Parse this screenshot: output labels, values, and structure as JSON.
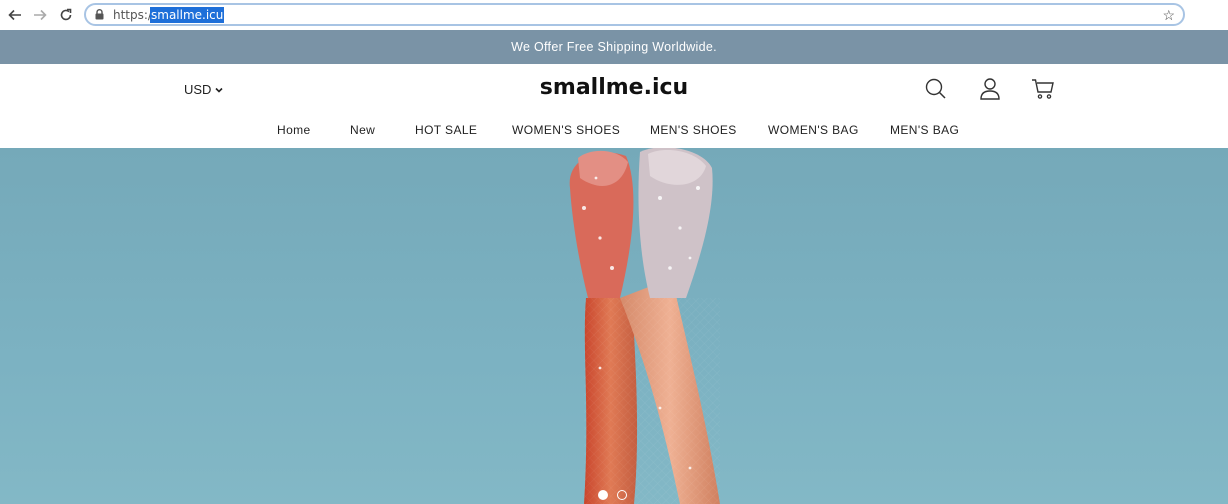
{
  "browser": {
    "url_scheme": "https://",
    "url_host": "smallme.icu"
  },
  "announcement": {
    "text": "We Offer Free Shipping Worldwide."
  },
  "header": {
    "currency": "USD",
    "logo": "smallme.icu",
    "icons": [
      "search-icon",
      "account-icon",
      "cart-icon"
    ]
  },
  "menu": {
    "items": [
      {
        "label": "Home"
      },
      {
        "label": "New"
      },
      {
        "label": "HOT SALE"
      },
      {
        "label": "WOMEN'S SHOES"
      },
      {
        "label": "MEN'S SHOES"
      },
      {
        "label": "WOMEN'S BAG"
      },
      {
        "label": "MEN'S BAG"
      }
    ]
  },
  "hero": {
    "slide_count": 2,
    "active_slide": 1,
    "background_color": "#7cb2c2"
  },
  "colors": {
    "announcement_bg": "#7a93a6",
    "url_highlight": "#1e6fd9"
  }
}
